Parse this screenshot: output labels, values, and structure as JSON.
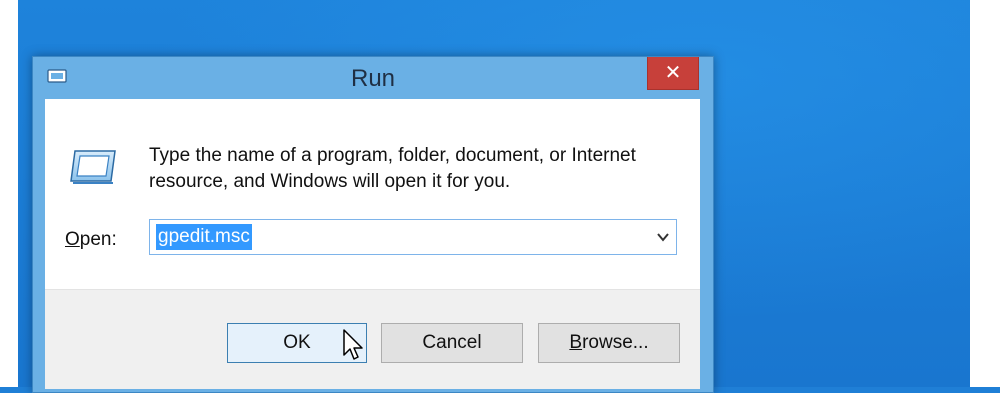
{
  "window": {
    "title": "Run",
    "close_label": "✕"
  },
  "dialog": {
    "description": "Type the name of a program, folder, document, or Internet resource, and Windows will open it for you.",
    "open_label_accel": "O",
    "open_label_rest": "pen:",
    "open_value": "gpedit.msc"
  },
  "buttons": {
    "ok": "OK",
    "cancel": "Cancel",
    "browse_accel": "B",
    "browse_rest": "rowse..."
  },
  "colors": {
    "desktop": "#1b78d0",
    "titlebar": "#6ab0e5",
    "close": "#c7403a",
    "selection": "#3399ff"
  },
  "icons": {
    "window": "run-dialog-icon",
    "close": "close-icon",
    "dropdown": "chevron-down-icon",
    "pointer": "mouse-pointer-icon"
  }
}
